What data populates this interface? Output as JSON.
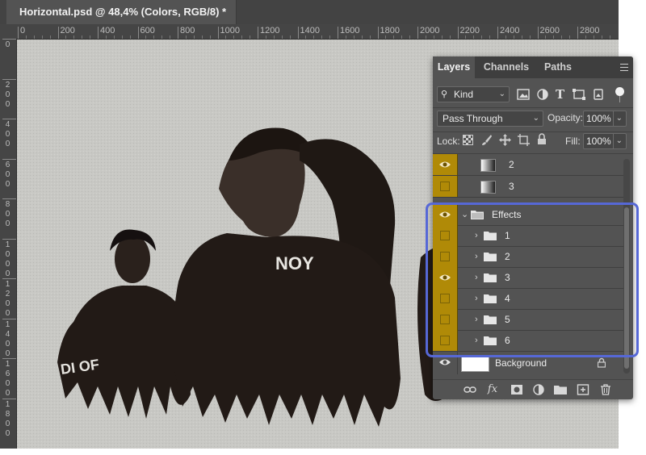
{
  "document": {
    "tab_title": "Horizontal.psd @ 48,4% (Colors, RGB/8) *",
    "ruler_h": [
      "0",
      "200",
      "400",
      "600",
      "800",
      "1000",
      "1200",
      "1400",
      "1600",
      "1800",
      "2000",
      "2200",
      "2400",
      "2600",
      "2800"
    ],
    "ruler_v": [
      "0",
      "200",
      "400",
      "600",
      "800",
      "1000",
      "1200",
      "1400",
      "1600",
      "1800"
    ],
    "canvas_text": {
      "hoodie_center": "NOY",
      "hoodie_left": "DI OF"
    }
  },
  "layers_panel": {
    "tabs": [
      "Layers",
      "Channels",
      "Paths"
    ],
    "active_tab": "Layers",
    "filter_label": "Kind",
    "blend_mode": "Pass Through",
    "opacity_label": "Opacity:",
    "opacity_value": "100%",
    "lock_label": "Lock:",
    "fill_label": "Fill:",
    "fill_value": "100%",
    "layers": [
      {
        "name": "2",
        "type": "gradient",
        "visible": true
      },
      {
        "name": "3",
        "type": "gradient",
        "visible": false
      },
      {
        "name": "Effects",
        "type": "group-open",
        "visible": true
      },
      {
        "name": "1",
        "type": "group",
        "visible": false
      },
      {
        "name": "2",
        "type": "group",
        "visible": false
      },
      {
        "name": "3",
        "type": "group",
        "visible": true
      },
      {
        "name": "4",
        "type": "group",
        "visible": false
      },
      {
        "name": "5",
        "type": "group",
        "visible": false
      },
      {
        "name": "6",
        "type": "group",
        "visible": false
      },
      {
        "name": "Background",
        "type": "background",
        "visible": true
      }
    ],
    "bottom_icons": [
      "link-icon",
      "fx-icon",
      "mask-icon",
      "adjustment-icon",
      "new-group-icon",
      "new-layer-icon",
      "trash-icon"
    ],
    "fx_label": "fx"
  },
  "colors": {
    "highlight": "#5668d6",
    "eye_cell": "#b08a07",
    "panel_bg": "#535353"
  }
}
